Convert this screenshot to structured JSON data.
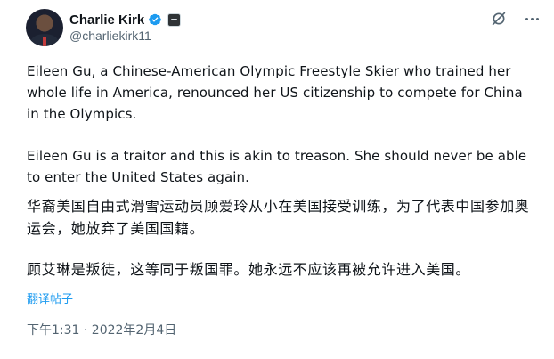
{
  "author": {
    "display_name": "Charlie Kirk",
    "handle": "@charliekirk11"
  },
  "icons": {
    "verified": "verified-badge-icon",
    "affiliation": "affiliation-badge-icon",
    "grok": "grok-icon",
    "more": "more-options-icon"
  },
  "colors": {
    "verified": "#1d9bf0",
    "link": "#1d9bf0",
    "secondary_text": "#536471"
  },
  "tweet": {
    "paragraph_1": "Eileen Gu, a Chinese-American Olympic Freestyle Skier who trained her whole life in America, renounced her US citizenship to compete for China in the Olympics.",
    "paragraph_2": "Eileen Gu is a traitor and this is akin to treason. She should never be able to enter the United States again.",
    "paragraph_3": "华裔美国自由式滑雪运动员顾爱玲从小在美国接受训练，为了代表中国参加奥运会，她放弃了美国国籍。",
    "paragraph_4": "顾艾琳是叛徒，这等同于叛国罪。她永远不应该再被允许进入美国。",
    "translate_label": "翻译帖子",
    "timestamp": "下午1:31 · 2022年2月4日"
  }
}
